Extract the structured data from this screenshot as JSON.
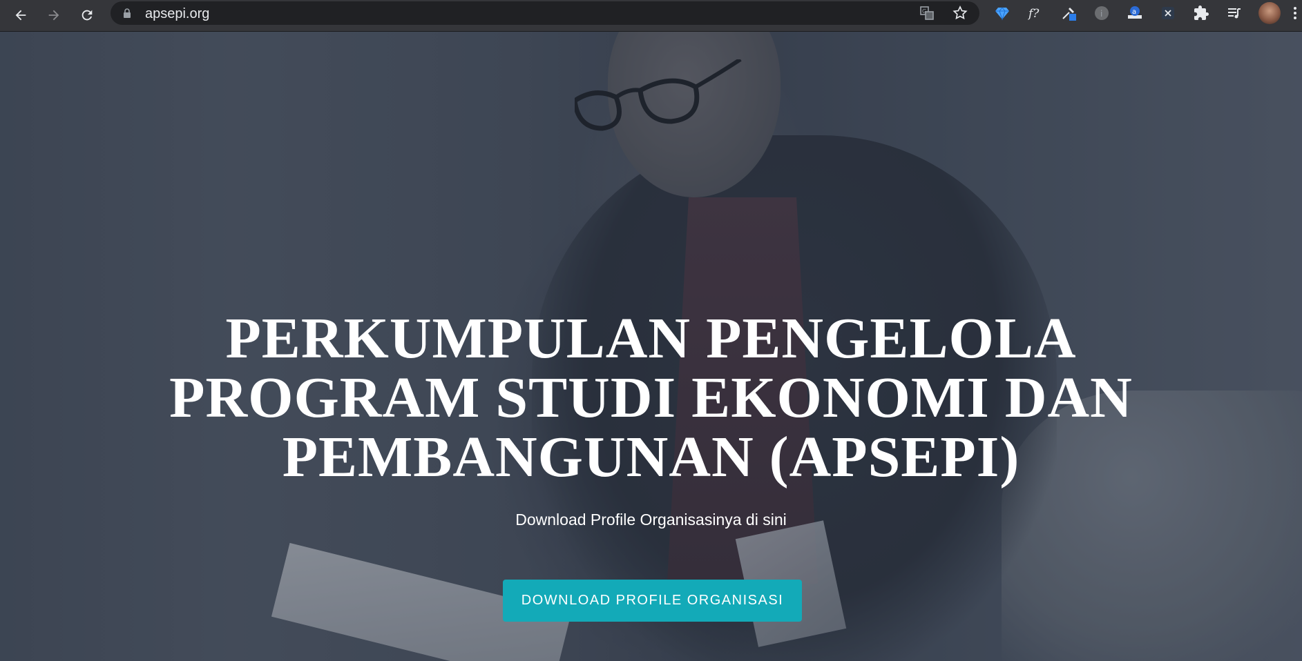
{
  "browser": {
    "url": "apsepi.org",
    "extensions": [
      "gem-icon",
      "font-finder-icon",
      "eyedropper-icon",
      "info-circle-icon",
      "amazon-assistant-icon",
      "x-extension-icon",
      "puzzle-icon",
      "media-queue-icon",
      "profile-avatar"
    ]
  },
  "hero": {
    "title": "PERKUMPULAN PENGELOLA PROGRAM STUDI EKONOMI DAN PEMBANGUNAN (APSEPI)",
    "subtitle": "Download Profile Organisasinya di sini",
    "cta_label": "DOWNLOAD PROFILE ORGANISASI"
  },
  "colors": {
    "cta": "#13aab8",
    "toolbar": "#35363a"
  }
}
